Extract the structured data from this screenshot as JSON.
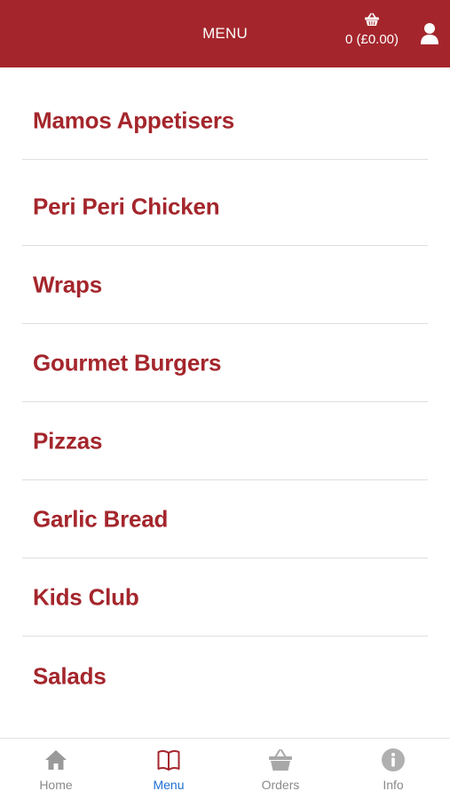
{
  "header": {
    "title": "MENU",
    "cart_text": "0 (£0.00)",
    "cart_icon": "basket-icon",
    "user_icon": "user-icon"
  },
  "menu": {
    "items": [
      {
        "label": "Mamos Appetisers"
      },
      {
        "label": "Peri Peri Chicken"
      },
      {
        "label": "Wraps"
      },
      {
        "label": "Gourmet Burgers"
      },
      {
        "label": "Pizzas"
      },
      {
        "label": "Garlic Bread"
      },
      {
        "label": "Kids Club"
      },
      {
        "label": "Salads"
      }
    ]
  },
  "bottom_nav": {
    "items": [
      {
        "label": "Home",
        "icon": "home-icon",
        "active": false
      },
      {
        "label": "Menu",
        "icon": "book-icon",
        "active": true
      },
      {
        "label": "Orders",
        "icon": "basket-icon",
        "active": false
      },
      {
        "label": "Info",
        "icon": "info-icon",
        "active": false
      }
    ]
  },
  "colors": {
    "brand": "#a4262c",
    "active_nav": "#1e6fd6",
    "inactive_nav": "#8a8a8a",
    "divider": "#dedede"
  }
}
